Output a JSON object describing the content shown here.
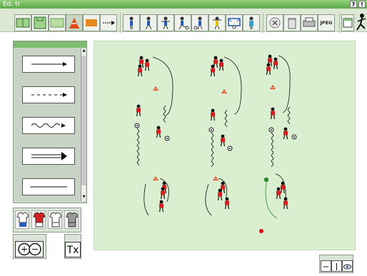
{
  "window": {
    "title": "Ed. tr",
    "help_label": "?",
    "alert_label": "!"
  },
  "toolbar": {
    "tools": [
      {
        "name": "pitch-full-icon"
      },
      {
        "name": "pitch-half-icon"
      },
      {
        "name": "pitch-grass-icon"
      },
      {
        "name": "cone-icon"
      },
      {
        "name": "rectangle-icon"
      },
      {
        "name": "arrow-tool-icon"
      },
      {
        "name": "player-stand-icon"
      },
      {
        "name": "player-run-icon"
      },
      {
        "name": "player-goalkeeper-icon"
      },
      {
        "name": "player-shoot-icon"
      },
      {
        "name": "player-pass-icon"
      },
      {
        "name": "player-jump-icon"
      },
      {
        "name": "goal-icon"
      },
      {
        "name": "coach-icon"
      }
    ],
    "delete_label": "✕",
    "jpeg_label": "JPEG"
  },
  "palette": {
    "lines": [
      {
        "name": "solid-arrow"
      },
      {
        "name": "dashed-arrow"
      },
      {
        "name": "wavy-arrow"
      },
      {
        "name": "double-arrow"
      },
      {
        "name": "plain-line"
      }
    ]
  },
  "shirts": [
    {
      "color": "#2a5ab8"
    },
    {
      "color": "#d42020"
    },
    {
      "color": "#ffffff"
    },
    {
      "color": "#9a9a9a"
    }
  ],
  "text_tool_label": "Tx",
  "colors": {
    "player": "#d42020",
    "accent": "#7dbd72",
    "field": "#daeed0"
  }
}
